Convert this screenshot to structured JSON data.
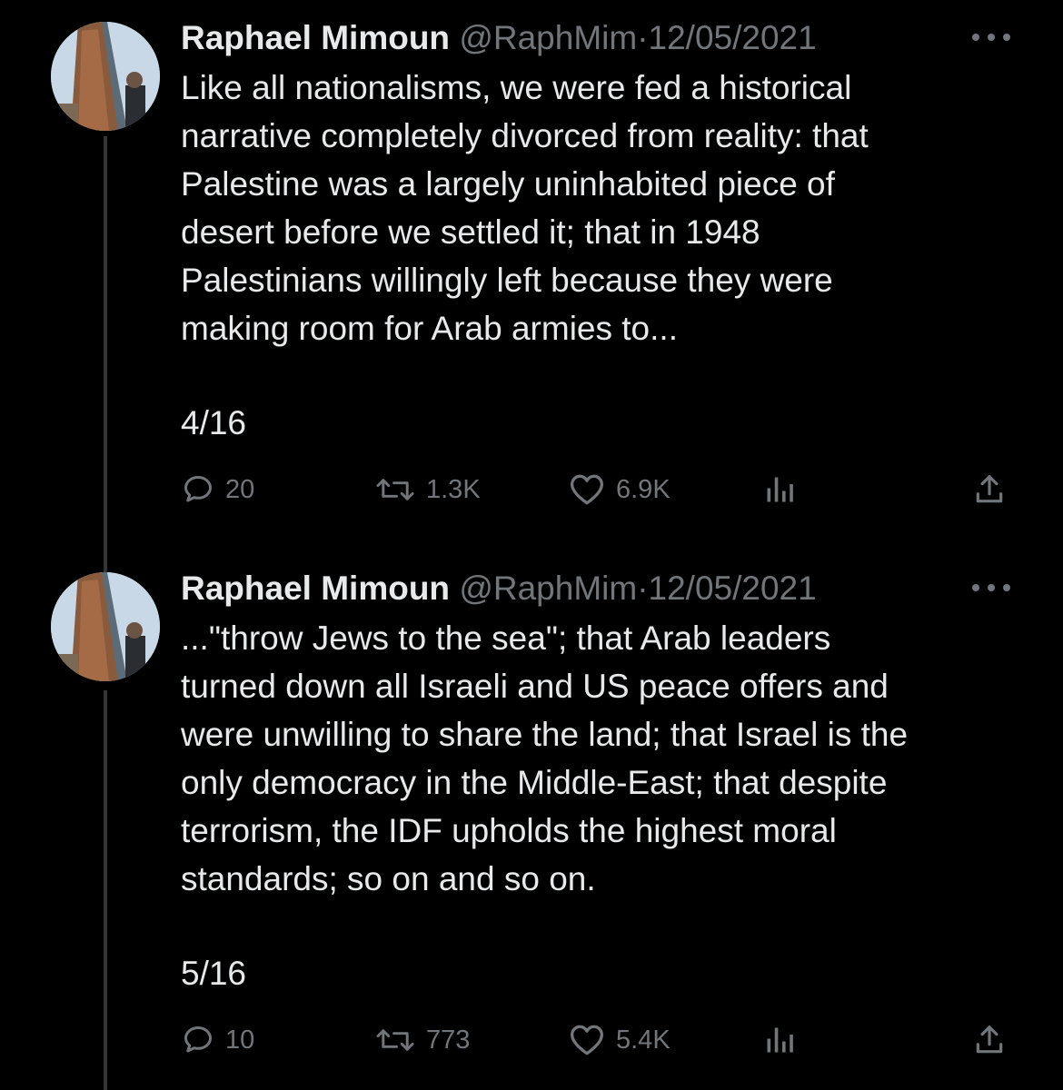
{
  "tweets": [
    {
      "author_name": "Raphael Mimoun",
      "handle": "@RaphMim",
      "separator": "·",
      "date": "12/05/2021",
      "text": "Like all nationalisms, we were fed a historical\nnarrative completely divorced from reality: that\nPalestine was a largely uninhabited piece of\ndesert before we settled it; that in 1948\nPalestinians willingly left because they were\nmaking room for Arab armies to...",
      "thread_counter": "4/16",
      "replies": "20",
      "retweets": "1.3K",
      "likes": "6.9K"
    },
    {
      "author_name": "Raphael Mimoun",
      "handle": "@RaphMim",
      "separator": "·",
      "date": "12/05/2021",
      "text": "...\"throw Jews to the sea\"; that Arab leaders\nturned down all Israeli and US peace offers and\nwere unwilling to share the land; that Israel is the\nonly democracy in the Middle-East; that despite\nterrorism, the IDF upholds the highest moral\nstandards; so on and so on.",
      "thread_counter": "5/16",
      "replies": "10",
      "retweets": "773",
      "likes": "5.4K"
    }
  ],
  "icons": {
    "reply": "reply-icon",
    "retweet": "retweet-icon",
    "like": "heart-icon",
    "views": "analytics-icon",
    "share": "share-icon",
    "more": "more-icon"
  },
  "colors": {
    "background": "#000000",
    "text": "#e7e9ea",
    "secondary": "#71767b",
    "thread_line": "#333639"
  }
}
